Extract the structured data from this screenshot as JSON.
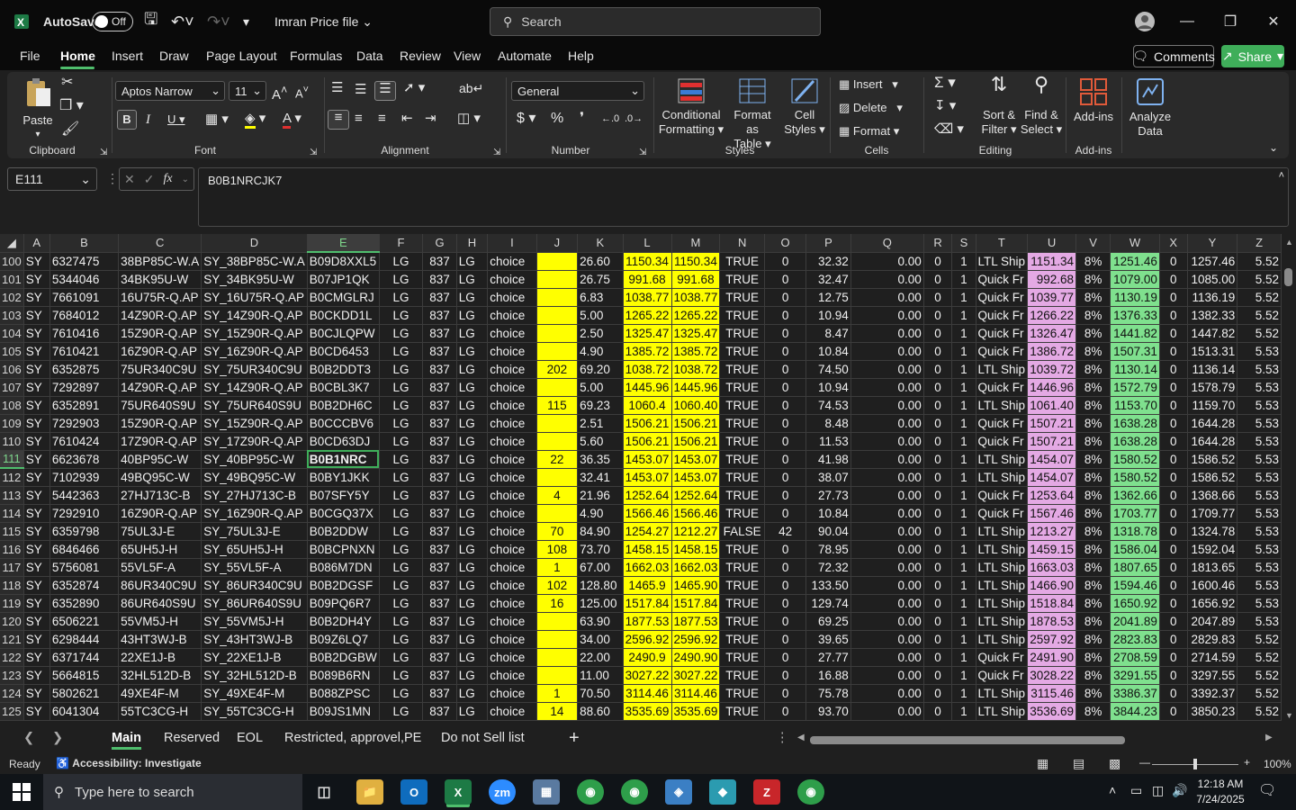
{
  "title": {
    "autosave": "AutoSave",
    "toggle": "Off",
    "filename": "Imran Price file",
    "search_placeholder": "Search"
  },
  "menu": [
    "File",
    "Home",
    "Insert",
    "Draw",
    "Page Layout",
    "Formulas",
    "Data",
    "Review",
    "View",
    "Automate",
    "Help"
  ],
  "comments": "Comments",
  "share": "Share",
  "ribbon": {
    "paste": "Paste",
    "clipboard": "Clipboard",
    "font_name": "Aptos Narrow",
    "font_size": "11",
    "font": "Font",
    "alignment": "Alignment",
    "number_format": "General",
    "number": "Number",
    "conditional": "Conditional",
    "formatting": "Formatting",
    "format_as": "Format as",
    "table": "Table",
    "cell": "Cell",
    "styles_btn": "Styles",
    "styles": "Styles",
    "insert": "Insert",
    "delete": "Delete",
    "format": "Format",
    "cells": "Cells",
    "sort": "Sort &",
    "filter": "Filter",
    "find": "Find &",
    "select": "Select",
    "editing": "Editing",
    "addins_btn": "Add-ins",
    "addins": "Add-ins",
    "analyze": "Analyze",
    "data": "Data"
  },
  "formula": {
    "namebox": "E111",
    "content": "B0B1NRCJK7"
  },
  "columns": [
    "A",
    "B",
    "C",
    "D",
    "E",
    "F",
    "G",
    "H",
    "I",
    "J",
    "K",
    "L",
    "M",
    "N",
    "O",
    "P",
    "Q",
    "R",
    "S",
    "T",
    "U",
    "V",
    "W",
    "X",
    "Y",
    "Z"
  ],
  "rows": [
    [
      "100",
      "SY",
      "6327475",
      "38BP85C-W.A",
      "SY_38BP85C-W.A",
      "B09D8XXL5",
      "LG",
      "837",
      "LG",
      "choice",
      "",
      "26.60",
      "1150.34",
      "1150.34",
      "TRUE",
      "0",
      "32.32",
      "0.00",
      "0",
      "1",
      "LTL Ship",
      "1151.34",
      "8%",
      "1251.46",
      "0",
      "1257.46",
      "5.52"
    ],
    [
      "101",
      "SY",
      "5344046",
      "34BK95U-W",
      "SY_34BK95U-W",
      "B07JP1QK",
      "LG",
      "837",
      "LG",
      "choice",
      "",
      "26.75",
      "991.68",
      "991.68",
      "TRUE",
      "0",
      "32.47",
      "0.00",
      "0",
      "1",
      "Quick Fr",
      "992.68",
      "8%",
      "1079.00",
      "0",
      "1085.00",
      "5.52"
    ],
    [
      "102",
      "SY",
      "7661091",
      "16U75R-Q.AP",
      "SY_16U75R-Q.AP",
      "B0CMGLRJ",
      "LG",
      "837",
      "LG",
      "choice",
      "",
      "6.83",
      "1038.77",
      "1038.77",
      "TRUE",
      "0",
      "12.75",
      "0.00",
      "0",
      "1",
      "Quick Fr",
      "1039.77",
      "8%",
      "1130.19",
      "0",
      "1136.19",
      "5.52"
    ],
    [
      "103",
      "SY",
      "7684012",
      "14Z90R-Q.AP",
      "SY_14Z90R-Q.AP",
      "B0CKDD1L",
      "LG",
      "837",
      "LG",
      "choice",
      "",
      "5.00",
      "1265.22",
      "1265.22",
      "TRUE",
      "0",
      "10.94",
      "0.00",
      "0",
      "1",
      "Quick Fr",
      "1266.22",
      "8%",
      "1376.33",
      "0",
      "1382.33",
      "5.52"
    ],
    [
      "104",
      "SY",
      "7610416",
      "15Z90R-Q.AP",
      "SY_15Z90R-Q.AP",
      "B0CJLQPW",
      "LG",
      "837",
      "LG",
      "choice",
      "",
      "2.50",
      "1325.47",
      "1325.47",
      "TRUE",
      "0",
      "8.47",
      "0.00",
      "0",
      "1",
      "Quick Fr",
      "1326.47",
      "8%",
      "1441.82",
      "0",
      "1447.82",
      "5.52"
    ],
    [
      "105",
      "SY",
      "7610421",
      "16Z90R-Q.AP",
      "SY_16Z90R-Q.AP",
      "B0CD6453",
      "LG",
      "837",
      "LG",
      "choice",
      "",
      "4.90",
      "1385.72",
      "1385.72",
      "TRUE",
      "0",
      "10.84",
      "0.00",
      "0",
      "1",
      "Quick Fr",
      "1386.72",
      "8%",
      "1507.31",
      "0",
      "1513.31",
      "5.53"
    ],
    [
      "106",
      "SY",
      "6352875",
      "75UR340C9U",
      "SY_75UR340C9U",
      "B0B2DDT3",
      "LG",
      "837",
      "LG",
      "choice",
      "202",
      "69.20",
      "1038.72",
      "1038.72",
      "TRUE",
      "0",
      "74.50",
      "0.00",
      "0",
      "1",
      "LTL Ship",
      "1039.72",
      "8%",
      "1130.14",
      "0",
      "1136.14",
      "5.53"
    ],
    [
      "107",
      "SY",
      "7292897",
      "14Z90R-Q.AP",
      "SY_14Z90R-Q.AP",
      "B0CBL3K7",
      "LG",
      "837",
      "LG",
      "choice",
      "",
      "5.00",
      "1445.96",
      "1445.96",
      "TRUE",
      "0",
      "10.94",
      "0.00",
      "0",
      "1",
      "Quick Fr",
      "1446.96",
      "8%",
      "1572.79",
      "0",
      "1578.79",
      "5.53"
    ],
    [
      "108",
      "SY",
      "6352891",
      "75UR640S9U",
      "SY_75UR640S9U",
      "B0B2DH6C",
      "LG",
      "837",
      "LG",
      "choice",
      "115",
      "69.23",
      "1060.4",
      "1060.40",
      "TRUE",
      "0",
      "74.53",
      "0.00",
      "0",
      "1",
      "LTL Ship",
      "1061.40",
      "8%",
      "1153.70",
      "0",
      "1159.70",
      "5.53"
    ],
    [
      "109",
      "SY",
      "7292903",
      "15Z90R-Q.AP",
      "SY_15Z90R-Q.AP",
      "B0CCCBV6",
      "LG",
      "837",
      "LG",
      "choice",
      "",
      "2.51",
      "1506.21",
      "1506.21",
      "TRUE",
      "0",
      "8.48",
      "0.00",
      "0",
      "1",
      "Quick Fr",
      "1507.21",
      "8%",
      "1638.28",
      "0",
      "1644.28",
      "5.53"
    ],
    [
      "110",
      "SY",
      "7610424",
      "17Z90R-Q.AP",
      "SY_17Z90R-Q.AP",
      "B0CD63DJ",
      "LG",
      "837",
      "LG",
      "choice",
      "",
      "5.60",
      "1506.21",
      "1506.21",
      "TRUE",
      "0",
      "11.53",
      "0.00",
      "0",
      "1",
      "Quick Fr",
      "1507.21",
      "8%",
      "1638.28",
      "0",
      "1644.28",
      "5.53"
    ],
    [
      "111",
      "SY",
      "6623678",
      "40BP95C-W",
      "SY_40BP95C-W",
      "B0B1NRC",
      "LG",
      "837",
      "LG",
      "choice",
      "22",
      "36.35",
      "1453.07",
      "1453.07",
      "TRUE",
      "0",
      "41.98",
      "0.00",
      "0",
      "1",
      "LTL Ship",
      "1454.07",
      "8%",
      "1580.52",
      "0",
      "1586.52",
      "5.53"
    ],
    [
      "112",
      "SY",
      "7102939",
      "49BQ95C-W",
      "SY_49BQ95C-W",
      "B0BY1JKK",
      "LG",
      "837",
      "LG",
      "choice",
      "",
      "32.41",
      "1453.07",
      "1453.07",
      "TRUE",
      "0",
      "38.07",
      "0.00",
      "0",
      "1",
      "LTL Ship",
      "1454.07",
      "8%",
      "1580.52",
      "0",
      "1586.52",
      "5.53"
    ],
    [
      "113",
      "SY",
      "5442363",
      "27HJ713C-B",
      "SY_27HJ713C-B",
      "B07SFY5Y",
      "LG",
      "837",
      "LG",
      "choice",
      "4",
      "21.96",
      "1252.64",
      "1252.64",
      "TRUE",
      "0",
      "27.73",
      "0.00",
      "0",
      "1",
      "Quick Fr",
      "1253.64",
      "8%",
      "1362.66",
      "0",
      "1368.66",
      "5.53"
    ],
    [
      "114",
      "SY",
      "7292910",
      "16Z90R-Q.AP",
      "SY_16Z90R-Q.AP",
      "B0CGQ37X",
      "LG",
      "837",
      "LG",
      "choice",
      "",
      "4.90",
      "1566.46",
      "1566.46",
      "TRUE",
      "0",
      "10.84",
      "0.00",
      "0",
      "1",
      "Quick Fr",
      "1567.46",
      "8%",
      "1703.77",
      "0",
      "1709.77",
      "5.53"
    ],
    [
      "115",
      "SY",
      "6359798",
      "75UL3J-E",
      "SY_75UL3J-E",
      "B0B2DDW",
      "LG",
      "837",
      "LG",
      "choice",
      "70",
      "84.90",
      "1254.27",
      "1212.27",
      "FALSE",
      "42",
      "90.04",
      "0.00",
      "0",
      "1",
      "LTL Ship",
      "1213.27",
      "8%",
      "1318.78",
      "0",
      "1324.78",
      "5.53"
    ],
    [
      "116",
      "SY",
      "6846466",
      "65UH5J-H",
      "SY_65UH5J-H",
      "B0BCPNXN",
      "LG",
      "837",
      "LG",
      "choice",
      "108",
      "73.70",
      "1458.15",
      "1458.15",
      "TRUE",
      "0",
      "78.95",
      "0.00",
      "0",
      "1",
      "LTL Ship",
      "1459.15",
      "8%",
      "1586.04",
      "0",
      "1592.04",
      "5.53"
    ],
    [
      "117",
      "SY",
      "5756081",
      "55VL5F-A",
      "SY_55VL5F-A",
      "B086M7DN",
      "LG",
      "837",
      "LG",
      "choice",
      "1",
      "67.00",
      "1662.03",
      "1662.03",
      "TRUE",
      "0",
      "72.32",
      "0.00",
      "0",
      "1",
      "LTL Ship",
      "1663.03",
      "8%",
      "1807.65",
      "0",
      "1813.65",
      "5.53"
    ],
    [
      "118",
      "SY",
      "6352874",
      "86UR340C9U",
      "SY_86UR340C9U",
      "B0B2DGSF",
      "LG",
      "837",
      "LG",
      "choice",
      "102",
      "128.80",
      "1465.9",
      "1465.90",
      "TRUE",
      "0",
      "133.50",
      "0.00",
      "0",
      "1",
      "LTL Ship",
      "1466.90",
      "8%",
      "1594.46",
      "0",
      "1600.46",
      "5.53"
    ],
    [
      "119",
      "SY",
      "6352890",
      "86UR640S9U",
      "SY_86UR640S9U",
      "B09PQ6R7",
      "LG",
      "837",
      "LG",
      "choice",
      "16",
      "125.00",
      "1517.84",
      "1517.84",
      "TRUE",
      "0",
      "129.74",
      "0.00",
      "0",
      "1",
      "LTL Ship",
      "1518.84",
      "8%",
      "1650.92",
      "0",
      "1656.92",
      "5.53"
    ],
    [
      "120",
      "SY",
      "6506221",
      "55VM5J-H",
      "SY_55VM5J-H",
      "B0B2DH4Y",
      "LG",
      "837",
      "LG",
      "choice",
      "",
      "63.90",
      "1877.53",
      "1877.53",
      "TRUE",
      "0",
      "69.25",
      "0.00",
      "0",
      "1",
      "LTL Ship",
      "1878.53",
      "8%",
      "2041.89",
      "0",
      "2047.89",
      "5.53"
    ],
    [
      "121",
      "SY",
      "6298444",
      "43HT3WJ-B",
      "SY_43HT3WJ-B",
      "B09Z6LQ7",
      "LG",
      "837",
      "LG",
      "choice",
      "",
      "34.00",
      "2596.92",
      "2596.92",
      "TRUE",
      "0",
      "39.65",
      "0.00",
      "0",
      "1",
      "LTL Ship",
      "2597.92",
      "8%",
      "2823.83",
      "0",
      "2829.83",
      "5.52"
    ],
    [
      "122",
      "SY",
      "6371744",
      "22XE1J-B",
      "SY_22XE1J-B",
      "B0B2DGBW",
      "LG",
      "837",
      "LG",
      "choice",
      "",
      "22.00",
      "2490.9",
      "2490.90",
      "TRUE",
      "0",
      "27.77",
      "0.00",
      "0",
      "1",
      "Quick Fr",
      "2491.90",
      "8%",
      "2708.59",
      "0",
      "2714.59",
      "5.52"
    ],
    [
      "123",
      "SY",
      "5664815",
      "32HL512D-B",
      "SY_32HL512D-B",
      "B089B6RN",
      "LG",
      "837",
      "LG",
      "choice",
      "",
      "11.00",
      "3027.22",
      "3027.22",
      "TRUE",
      "0",
      "16.88",
      "0.00",
      "0",
      "1",
      "Quick Fr",
      "3028.22",
      "8%",
      "3291.55",
      "0",
      "3297.55",
      "5.52"
    ],
    [
      "124",
      "SY",
      "5802621",
      "49XE4F-M",
      "SY_49XE4F-M",
      "B088ZPSC",
      "LG",
      "837",
      "LG",
      "choice",
      "1",
      "70.50",
      "3114.46",
      "3114.46",
      "TRUE",
      "0",
      "75.78",
      "0.00",
      "0",
      "1",
      "LTL Ship",
      "3115.46",
      "8%",
      "3386.37",
      "0",
      "3392.37",
      "5.52"
    ],
    [
      "125",
      "SY",
      "6041304",
      "55TC3CG-H",
      "SY_55TC3CG-H",
      "B09JS1MN",
      "LG",
      "837",
      "LG",
      "choice",
      "14",
      "88.60",
      "3535.69",
      "3535.69",
      "TRUE",
      "0",
      "93.70",
      "0.00",
      "0",
      "1",
      "LTL Ship",
      "3536.69",
      "8%",
      "3844.23",
      "0",
      "3850.23",
      "5.52"
    ]
  ],
  "sheet_tabs": [
    "Main",
    "Reserved",
    "EOL",
    "Restricted, approvel,PE",
    "Do not Sell list"
  ],
  "status": {
    "ready": "Ready",
    "accessibility": "Accessibility: Investigate",
    "zoom": "100%"
  },
  "taskbar": {
    "search": "Type here to search",
    "time": "12:18 AM",
    "date": "7/24/2025"
  }
}
